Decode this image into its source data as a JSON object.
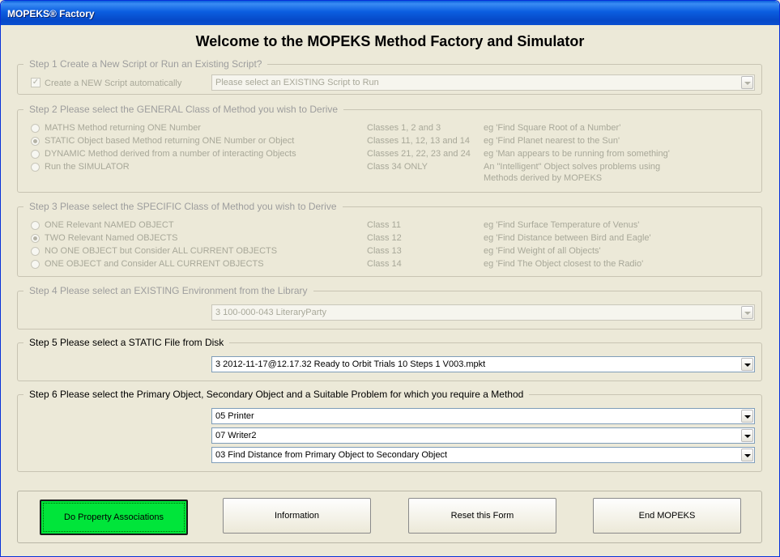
{
  "window": {
    "title": "MOPEKS® Factory"
  },
  "heading": "Welcome to the MOPEKS Method Factory and Simulator",
  "step1": {
    "legend": "Step 1   Create a New Script or Run an Existing Script?",
    "checkbox_label": "Create a NEW Script automatically",
    "checked": true,
    "combo_value": "Please select an EXISTING Script to Run"
  },
  "step2": {
    "legend": "Step 2   Please select the GENERAL Class of Method you wish to Derive",
    "options": [
      {
        "label": "MATHS Method returning ONE Number",
        "classes": "Classes 1, 2 and 3",
        "example": "eg 'Find Square Root of a Number'"
      },
      {
        "label": "STATIC Object based Method returning ONE Number or Object",
        "classes": "Classes 11, 12, 13 and 14",
        "example": "eg 'Find Planet nearest to the Sun'"
      },
      {
        "label": "DYNAMIC Method derived from a number of interacting Objects",
        "classes": "Classes 21, 22, 23 and 24",
        "example": "eg 'Man appears to be running from something'"
      },
      {
        "label": "Run the SIMULATOR",
        "classes": "Class 34 ONLY",
        "example": "An \"Intelligent\" Object solves problems using",
        "example2": "Methods derived  by MOPEKS"
      }
    ]
  },
  "step3": {
    "legend": "Step 3   Please select the SPECIFIC Class of Method you wish to Derive",
    "options": [
      {
        "label": "ONE Relevant NAMED OBJECT",
        "classes": "Class 11",
        "example": "eg 'Find Surface Temperature of Venus'"
      },
      {
        "label": "TWO Relevant Named OBJECTS",
        "classes": "Class 12",
        "example": "eg 'Find Distance between Bird and Eagle'"
      },
      {
        "label": "NO ONE OBJECT but Consider ALL CURRENT OBJECTS",
        "classes": "Class 13",
        "example": "eg 'Find Weight of all Objects'"
      },
      {
        "label": "ONE OBJECT and Consider ALL CURRENT OBJECTS",
        "classes": "Class 14",
        "example": "eg 'Find The Object closest to the Radio'"
      }
    ]
  },
  "step4": {
    "legend": "Step 4   Please select an EXISTING Environment from the Library",
    "combo_value": "3    100-000-043    LiteraryParty"
  },
  "step5": {
    "legend": "Step 5  Please select a STATIC File from Disk",
    "combo_value": "3    2012-11-17@12.17.32 Ready to Orbit Trials 10 Steps 1 V003.mpkt"
  },
  "step6": {
    "legend": "Step 6  Please select the Primary Object, Secondary Object and a Suitable Problem for which you require a Method",
    "primary": "05 Printer",
    "secondary": "07 Writer2",
    "problem": "03  Find Distance from Primary Object to Secondary Object"
  },
  "buttons": {
    "property": "Do Property Associations",
    "information": "Information",
    "reset": "Reset this Form",
    "end": "End MOPEKS"
  },
  "colors": {
    "accent_green": "#00e53a",
    "titlebar_blue": "#0a5fdc",
    "window_bg": "#ece9d8",
    "disabled_text": "#a8a899"
  }
}
